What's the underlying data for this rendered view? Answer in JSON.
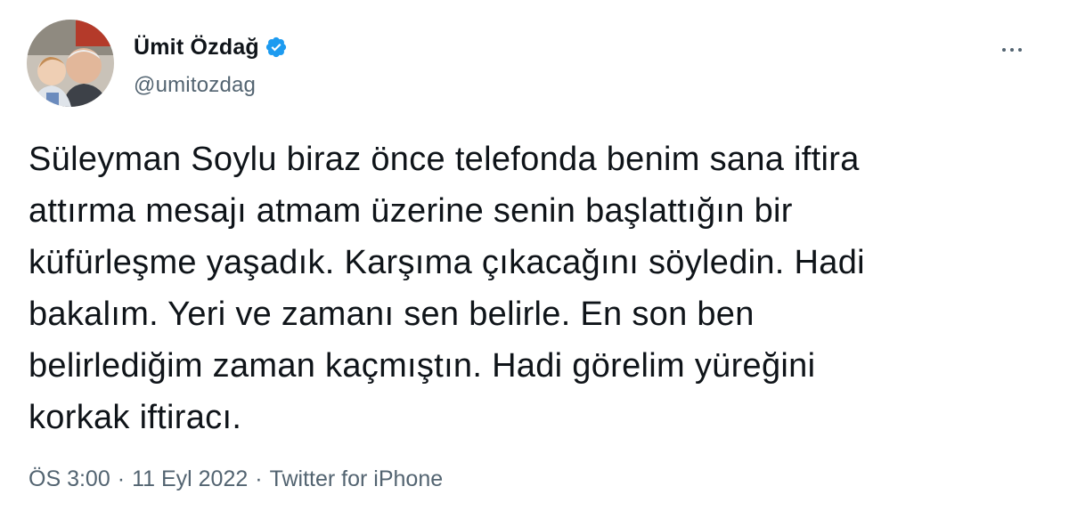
{
  "author": {
    "name": "Ümit Özdağ",
    "handle": "@umitozdag",
    "verified": true,
    "avatar": "profile-photo"
  },
  "tweet": {
    "text": "Süleyman Soylu biraz önce telefonda benim sana iftira\nattırma mesajı atmam üzerine senin başlattığın bir\nküfürleşme yaşadık. Karşıma çıkacağını söyledin. Hadi\nbakalım. Yeri ve zamanı sen belirle. En son ben\nbelirlediğim zaman kaçmıştın. Hadi görelim yüreğini\nkorkak iftiracı."
  },
  "meta": {
    "time": "ÖS 3:00",
    "separator": "·",
    "date": "11 Eyl 2022",
    "source": "Twitter for iPhone"
  },
  "icons": {
    "verified": "verified-badge-icon",
    "more": "more-options-icon"
  },
  "colors": {
    "text": "#0f1419",
    "secondary": "#536471",
    "verified": "#1d9bf0"
  }
}
